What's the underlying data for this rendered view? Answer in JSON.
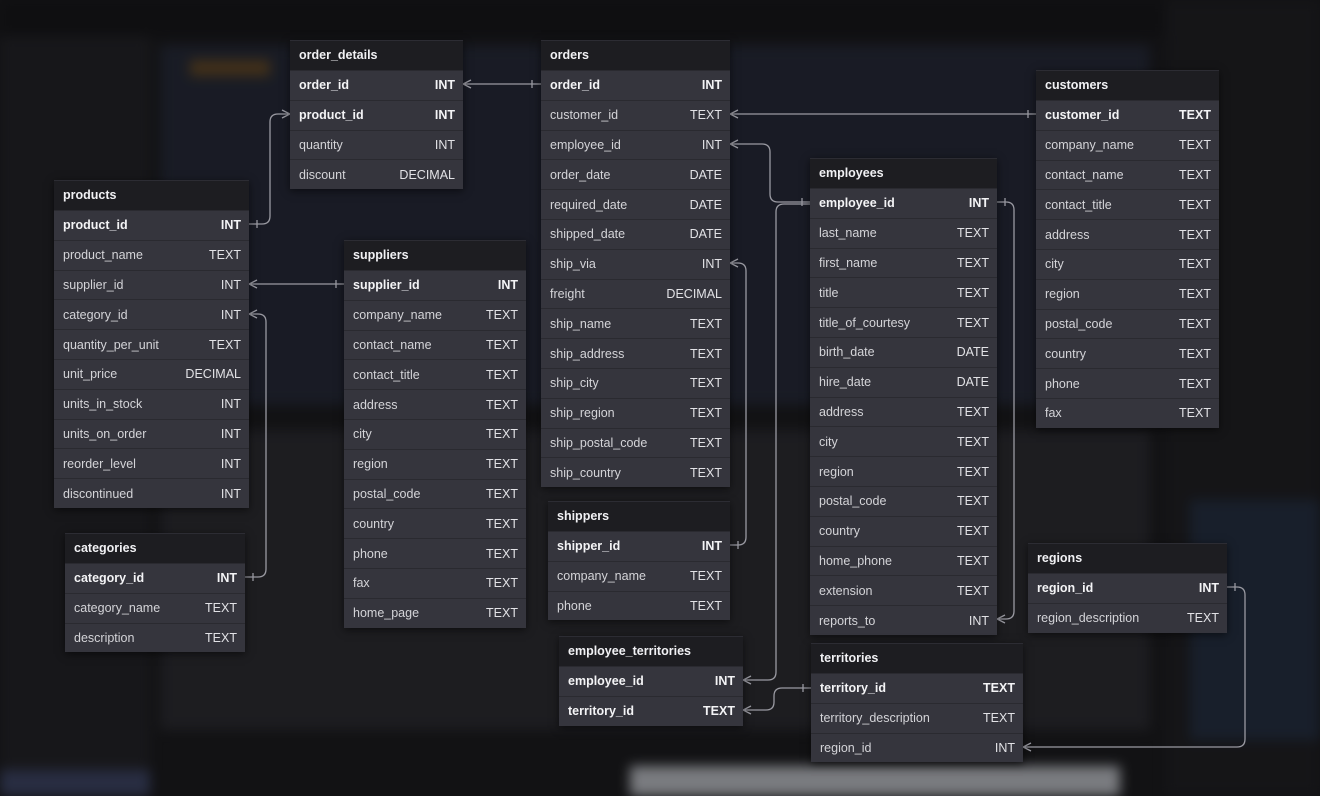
{
  "tables": [
    {
      "id": "order_details",
      "name": "order_details",
      "columns": [
        {
          "name": "order_id",
          "type": "INT",
          "pk": true
        },
        {
          "name": "product_id",
          "type": "INT",
          "pk": true
        },
        {
          "name": "quantity",
          "type": "INT"
        },
        {
          "name": "discount",
          "type": "DECIMAL"
        }
      ]
    },
    {
      "id": "orders",
      "name": "orders",
      "columns": [
        {
          "name": "order_id",
          "type": "INT",
          "pk": true
        },
        {
          "name": "customer_id",
          "type": "TEXT"
        },
        {
          "name": "employee_id",
          "type": "INT"
        },
        {
          "name": "order_date",
          "type": "DATE"
        },
        {
          "name": "required_date",
          "type": "DATE"
        },
        {
          "name": "shipped_date",
          "type": "DATE"
        },
        {
          "name": "ship_via",
          "type": "INT"
        },
        {
          "name": "freight",
          "type": "DECIMAL"
        },
        {
          "name": "ship_name",
          "type": "TEXT"
        },
        {
          "name": "ship_address",
          "type": "TEXT"
        },
        {
          "name": "ship_city",
          "type": "TEXT"
        },
        {
          "name": "ship_region",
          "type": "TEXT"
        },
        {
          "name": "ship_postal_code",
          "type": "TEXT"
        },
        {
          "name": "ship_country",
          "type": "TEXT"
        }
      ]
    },
    {
      "id": "customers",
      "name": "customers",
      "columns": [
        {
          "name": "customer_id",
          "type": "TEXT",
          "pk": true
        },
        {
          "name": "company_name",
          "type": "TEXT"
        },
        {
          "name": "contact_name",
          "type": "TEXT"
        },
        {
          "name": "contact_title",
          "type": "TEXT"
        },
        {
          "name": "address",
          "type": "TEXT"
        },
        {
          "name": "city",
          "type": "TEXT"
        },
        {
          "name": "region",
          "type": "TEXT"
        },
        {
          "name": "postal_code",
          "type": "TEXT"
        },
        {
          "name": "country",
          "type": "TEXT"
        },
        {
          "name": "phone",
          "type": "TEXT"
        },
        {
          "name": "fax",
          "type": "TEXT"
        }
      ]
    },
    {
      "id": "products",
      "name": "products",
      "columns": [
        {
          "name": "product_id",
          "type": "INT",
          "pk": true
        },
        {
          "name": "product_name",
          "type": "TEXT"
        },
        {
          "name": "supplier_id",
          "type": "INT"
        },
        {
          "name": "category_id",
          "type": "INT"
        },
        {
          "name": "quantity_per_unit",
          "type": "TEXT"
        },
        {
          "name": "unit_price",
          "type": "DECIMAL"
        },
        {
          "name": "units_in_stock",
          "type": "INT"
        },
        {
          "name": "units_on_order",
          "type": "INT"
        },
        {
          "name": "reorder_level",
          "type": "INT"
        },
        {
          "name": "discontinued",
          "type": "INT"
        }
      ]
    },
    {
      "id": "suppliers",
      "name": "suppliers",
      "columns": [
        {
          "name": "supplier_id",
          "type": "INT",
          "pk": true
        },
        {
          "name": "company_name",
          "type": "TEXT"
        },
        {
          "name": "contact_name",
          "type": "TEXT"
        },
        {
          "name": "contact_title",
          "type": "TEXT"
        },
        {
          "name": "address",
          "type": "TEXT"
        },
        {
          "name": "city",
          "type": "TEXT"
        },
        {
          "name": "region",
          "type": "TEXT"
        },
        {
          "name": "postal_code",
          "type": "TEXT"
        },
        {
          "name": "country",
          "type": "TEXT"
        },
        {
          "name": "phone",
          "type": "TEXT"
        },
        {
          "name": "fax",
          "type": "TEXT"
        },
        {
          "name": "home_page",
          "type": "TEXT"
        }
      ]
    },
    {
      "id": "employees",
      "name": "employees",
      "columns": [
        {
          "name": "employee_id",
          "type": "INT",
          "pk": true
        },
        {
          "name": "last_name",
          "type": "TEXT"
        },
        {
          "name": "first_name",
          "type": "TEXT"
        },
        {
          "name": "title",
          "type": "TEXT"
        },
        {
          "name": "title_of_courtesy",
          "type": "TEXT"
        },
        {
          "name": "birth_date",
          "type": "DATE"
        },
        {
          "name": "hire_date",
          "type": "DATE"
        },
        {
          "name": "address",
          "type": "TEXT"
        },
        {
          "name": "city",
          "type": "TEXT"
        },
        {
          "name": "region",
          "type": "TEXT"
        },
        {
          "name": "postal_code",
          "type": "TEXT"
        },
        {
          "name": "country",
          "type": "TEXT"
        },
        {
          "name": "home_phone",
          "type": "TEXT"
        },
        {
          "name": "extension",
          "type": "TEXT"
        },
        {
          "name": "reports_to",
          "type": "INT"
        }
      ]
    },
    {
      "id": "categories",
      "name": "categories",
      "columns": [
        {
          "name": "category_id",
          "type": "INT",
          "pk": true
        },
        {
          "name": "category_name",
          "type": "TEXT"
        },
        {
          "name": "description",
          "type": "TEXT"
        }
      ]
    },
    {
      "id": "shippers",
      "name": "shippers",
      "columns": [
        {
          "name": "shipper_id",
          "type": "INT",
          "pk": true
        },
        {
          "name": "company_name",
          "type": "TEXT"
        },
        {
          "name": "phone",
          "type": "TEXT"
        }
      ]
    },
    {
      "id": "regions",
      "name": "regions",
      "columns": [
        {
          "name": "region_id",
          "type": "INT",
          "pk": true
        },
        {
          "name": "region_description",
          "type": "TEXT"
        }
      ]
    },
    {
      "id": "employee_territories",
      "name": "employee_territories",
      "columns": [
        {
          "name": "employee_id",
          "type": "INT",
          "pk": true
        },
        {
          "name": "territory_id",
          "type": "TEXT",
          "pk": true
        }
      ]
    },
    {
      "id": "territories",
      "name": "territories",
      "columns": [
        {
          "name": "territory_id",
          "type": "TEXT",
          "pk": true
        },
        {
          "name": "territory_description",
          "type": "TEXT"
        },
        {
          "name": "region_id",
          "type": "INT"
        }
      ]
    }
  ],
  "relationships": [
    {
      "from": "order_details.order_id",
      "to": "orders.order_id"
    },
    {
      "from": "order_details.product_id",
      "to": "products.product_id"
    },
    {
      "from": "orders.customer_id",
      "to": "customers.customer_id"
    },
    {
      "from": "orders.employee_id",
      "to": "employees.employee_id"
    },
    {
      "from": "orders.ship_via",
      "to": "shippers.shipper_id"
    },
    {
      "from": "products.supplier_id",
      "to": "suppliers.supplier_id"
    },
    {
      "from": "products.category_id",
      "to": "categories.category_id"
    },
    {
      "from": "employees.reports_to",
      "to": "employees.employee_id"
    },
    {
      "from": "employee_territories.employee_id",
      "to": "employees.employee_id"
    },
    {
      "from": "employee_territories.territory_id",
      "to": "territories.territory_id"
    },
    {
      "from": "territories.region_id",
      "to": "regions.region_id"
    }
  ],
  "colors": {
    "table_bg": "#35353d",
    "header_bg": "#1d1d21",
    "edge": "#9a9aa2",
    "backdrop": "#121214"
  }
}
